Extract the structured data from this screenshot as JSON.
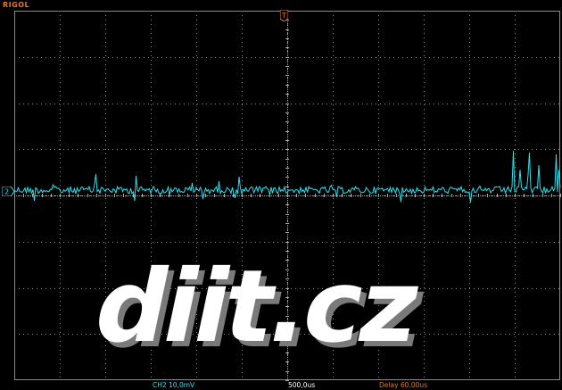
{
  "brand": "RIGOL",
  "channel_marker": "2",
  "trigger_marker": "T",
  "status_bar": {
    "channel_scale": "CH2 10,0mV",
    "time_base": "500,0us",
    "delay": "Delay 60,00us"
  },
  "watermark": "diit.cz",
  "colors": {
    "background": "#000000",
    "grid": "#8a8a8a",
    "trace": "#29e0ee",
    "brand": "#e87a1a",
    "delay": "#e87a1a"
  },
  "chart_data": {
    "type": "line",
    "series": [
      {
        "values": []
      }
    ],
    "grid": true
  }
}
